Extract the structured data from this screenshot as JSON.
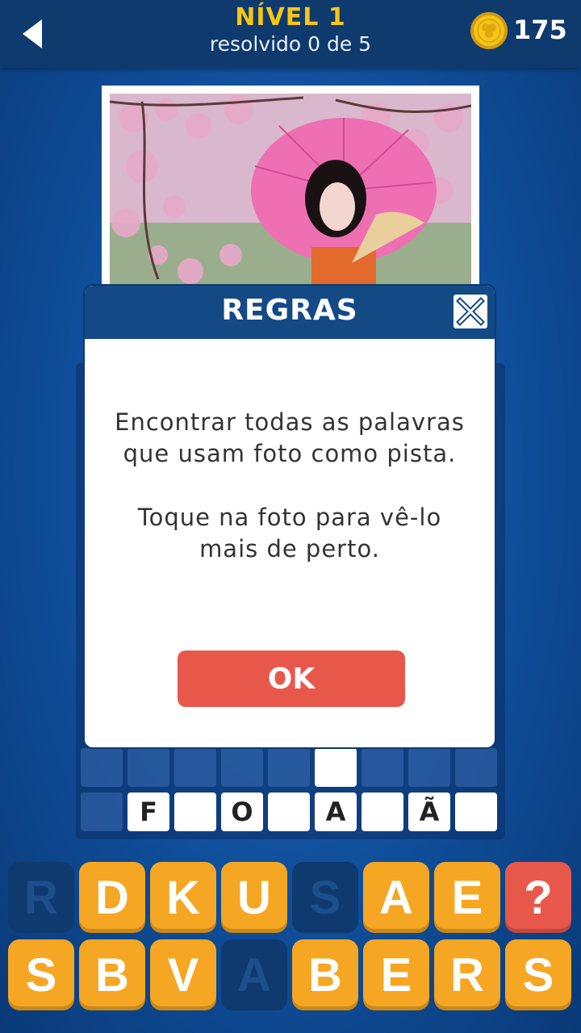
{
  "header": {
    "level_title": "NÍVEL 1",
    "progress_text": "resolvido 0 de 5",
    "coins": "175",
    "back_icon": "back-arrow-icon",
    "coin_icon": "coin-icon",
    "accent_color": "#f5c518"
  },
  "modal": {
    "title": "REGRAS",
    "line1": "Encontrar todas as palavras",
    "line2": "que usam foto como pista.",
    "line3": "Toque na foto para vê-lo",
    "line4": "mais de perto.",
    "ok_label": "OK",
    "close_icon": "close-icon"
  },
  "answer_row": {
    "letters": [
      "",
      "F",
      "",
      "O",
      "",
      "A",
      "",
      "Ã",
      ""
    ]
  },
  "keyboard": {
    "row1": [
      "R",
      "D",
      "K",
      "U",
      "S",
      "A",
      "E",
      "?"
    ],
    "row2": [
      "S",
      "B",
      "V",
      "A",
      "B",
      "E",
      "R",
      "S"
    ]
  },
  "colors": {
    "key_orange": "#f5a623",
    "hint_red": "#e8584a",
    "header_blue": "#134a86"
  }
}
